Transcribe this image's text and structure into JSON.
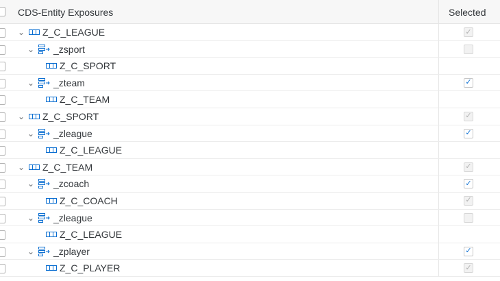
{
  "table": {
    "header_left": "CDS-Entity Exposures",
    "header_right": "Selected"
  },
  "rows": [
    {
      "level": 0,
      "kind": "entity",
      "expanded": true,
      "label": "Z_C_LEAGUE",
      "selected": "checked-disabled"
    },
    {
      "level": 1,
      "kind": "assoc",
      "expanded": true,
      "label": "_zsport",
      "selected": "unchecked-disabled"
    },
    {
      "level": 2,
      "kind": "entity",
      "expanded": false,
      "label": "Z_C_SPORT",
      "selected": "none"
    },
    {
      "level": 1,
      "kind": "assoc",
      "expanded": true,
      "label": "_zteam",
      "selected": "checked"
    },
    {
      "level": 2,
      "kind": "entity",
      "expanded": false,
      "label": "Z_C_TEAM",
      "selected": "none"
    },
    {
      "level": 0,
      "kind": "entity",
      "expanded": true,
      "label": "Z_C_SPORT",
      "selected": "checked-disabled"
    },
    {
      "level": 1,
      "kind": "assoc",
      "expanded": true,
      "label": "_zleague",
      "selected": "checked"
    },
    {
      "level": 2,
      "kind": "entity",
      "expanded": false,
      "label": "Z_C_LEAGUE",
      "selected": "none"
    },
    {
      "level": 0,
      "kind": "entity",
      "expanded": true,
      "label": "Z_C_TEAM",
      "selected": "checked-disabled"
    },
    {
      "level": 1,
      "kind": "assoc",
      "expanded": true,
      "label": "_zcoach",
      "selected": "checked"
    },
    {
      "level": 2,
      "kind": "entity",
      "expanded": false,
      "label": "Z_C_COACH",
      "selected": "checked-disabled"
    },
    {
      "level": 1,
      "kind": "assoc",
      "expanded": true,
      "label": "_zleague",
      "selected": "unchecked-disabled"
    },
    {
      "level": 2,
      "kind": "entity",
      "expanded": false,
      "label": "Z_C_LEAGUE",
      "selected": "none"
    },
    {
      "level": 1,
      "kind": "assoc",
      "expanded": true,
      "label": "_zplayer",
      "selected": "checked"
    },
    {
      "level": 2,
      "kind": "entity",
      "expanded": false,
      "label": "Z_C_PLAYER",
      "selected": "checked-disabled"
    }
  ],
  "icons": {
    "expand": "chevron-down-icon",
    "entity": "entity-icon",
    "association": "association-icon",
    "check": "check-icon"
  },
  "colors": {
    "accent": "#0a6ed1",
    "disabled_check": "#b0b0b0"
  }
}
